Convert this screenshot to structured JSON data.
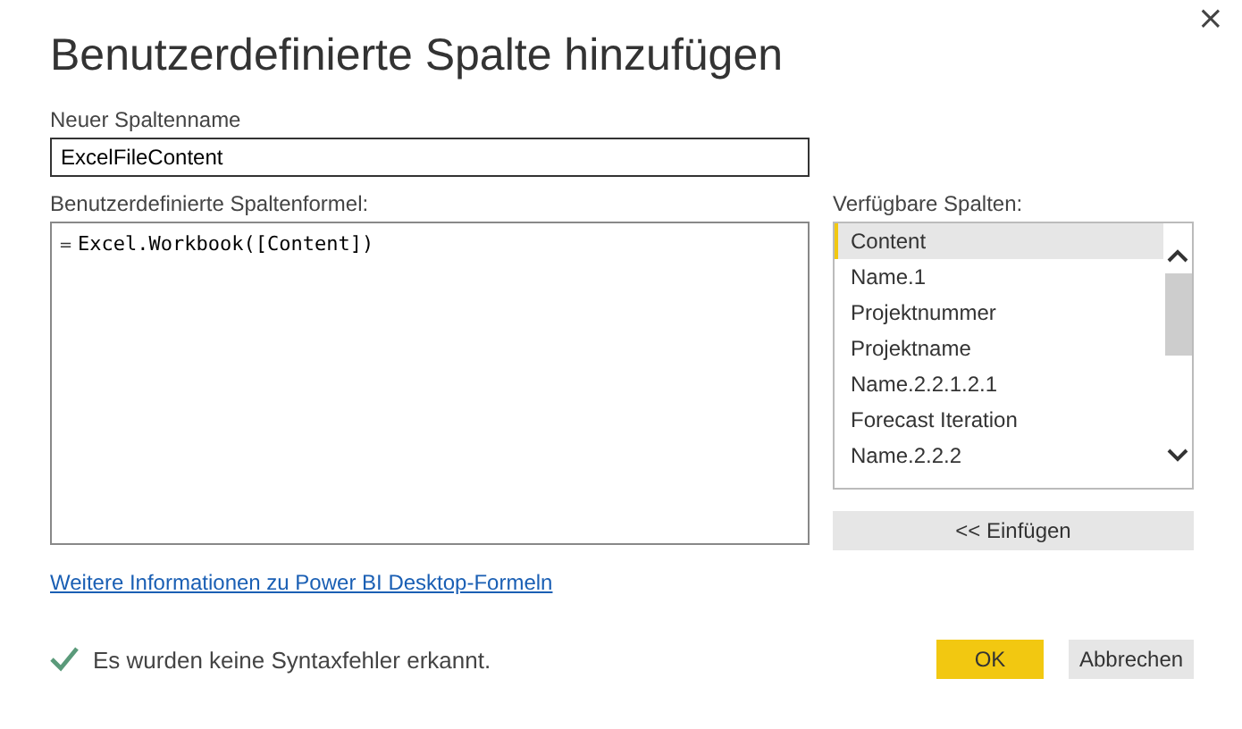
{
  "window": {
    "title": "Benutzerdefinierte Spalte hinzufügen",
    "close": "×"
  },
  "name_field": {
    "label": "Neuer Spaltenname",
    "value": "ExcelFileContent"
  },
  "formula": {
    "label": "Benutzerdefinierte Spaltenformel:",
    "prefix": "=",
    "value": "Excel.Workbook([Content])"
  },
  "available_columns": {
    "label": "Verfügbare Spalten:",
    "items": [
      {
        "label": "Content",
        "selected": true
      },
      {
        "label": "Name.1",
        "selected": false
      },
      {
        "label": "Projektnummer",
        "selected": false
      },
      {
        "label": "Projektname",
        "selected": false
      },
      {
        "label": "Name.2.2.1.2.1",
        "selected": false
      },
      {
        "label": "Forecast Iteration",
        "selected": false
      },
      {
        "label": "Name.2.2.2",
        "selected": false
      }
    ],
    "insert_button": "<< Einfügen"
  },
  "help_link": "Weitere Informationen zu Power BI Desktop-Formeln",
  "status": {
    "ok": true,
    "text": "Es wurden keine Syntaxfehler erkannt."
  },
  "buttons": [
    {
      "label": "OK",
      "kind": "primary"
    },
    {
      "label": "Abbrechen",
      "kind": "secondary"
    }
  ]
}
